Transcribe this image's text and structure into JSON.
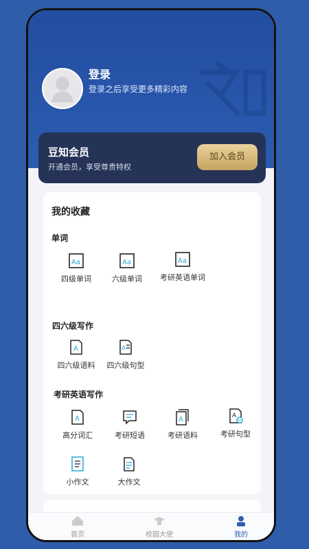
{
  "profile": {
    "title": "登录",
    "subtitle": "登录之后享受更多精彩内容"
  },
  "member": {
    "title": "豆知会员",
    "subtitle": "开通会员，享受尊贵特权",
    "button": "加入会员"
  },
  "favorites": {
    "title": "我的收藏",
    "groups": [
      {
        "title": "单词",
        "items": [
          {
            "label": "四级单词",
            "icon": "aa-icon"
          },
          {
            "label": "六级单词",
            "icon": "aa-icon"
          },
          {
            "label": "考研英语单词",
            "icon": "aa-icon"
          }
        ]
      },
      {
        "title": "四六级写作",
        "items": [
          {
            "label": "四六级语料",
            "icon": "document-a-icon"
          },
          {
            "label": "四六级句型",
            "icon": "document-lines-icon"
          }
        ]
      },
      {
        "title": "考研英语写作",
        "items": [
          {
            "label": "高分词汇",
            "icon": "document-a-icon"
          },
          {
            "label": "考研短语",
            "icon": "comment-icon"
          },
          {
            "label": "考研语料",
            "icon": "stacked-document-icon"
          },
          {
            "label": "考研句型",
            "icon": "document-badge-icon"
          },
          {
            "label": "小作文",
            "icon": "document-lines-icon"
          },
          {
            "label": "大作文",
            "icon": "document-stack-icon"
          }
        ]
      }
    ]
  },
  "tabs": [
    {
      "label": "首页"
    },
    {
      "label": "校园大使"
    },
    {
      "label": "我的"
    }
  ]
}
